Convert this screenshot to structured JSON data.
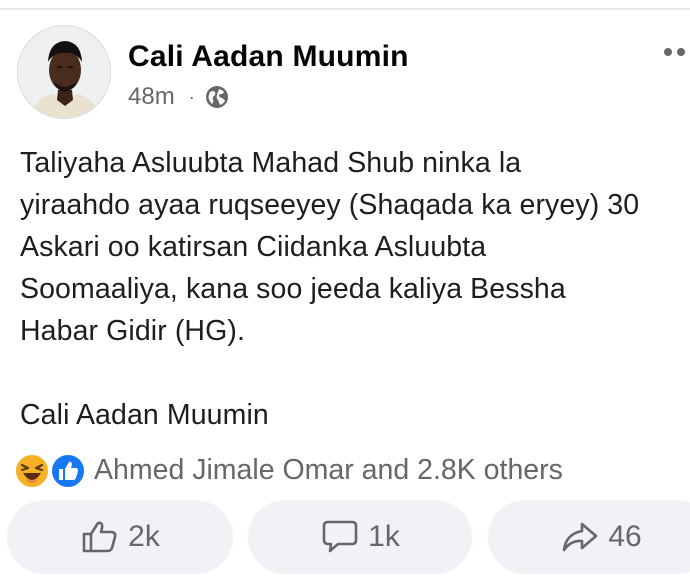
{
  "post": {
    "author": "Cali Aadan Muumin",
    "timestamp": "48m",
    "separator": "·",
    "audience_icon": "globe-icon",
    "body": "Taliyaha Asluubta Mahad Shub ninka la\nyiraahdo ayaa ruqseeyey (Shaqada ka eryey) 30\nAskari oo katirsan Ciidanka Asluubta\nSoomaaliya, kana soo jeeda kaliya Bessha\nHabar Gidir (HG).\n\nCali Aadan Muumin"
  },
  "reactions": {
    "icons": [
      "haha-emoji-icon",
      "like-reaction-icon"
    ],
    "summary": "Ahmed Jimale Omar and 2.8K others"
  },
  "actions": {
    "like_count": "2k",
    "comment_count": "1k",
    "share_count": "46"
  },
  "colors": {
    "like_blue": "#1877f2",
    "haha_yellow": "#f7b125",
    "secondary_text": "#65676b",
    "button_bg": "#f0f2f5"
  }
}
